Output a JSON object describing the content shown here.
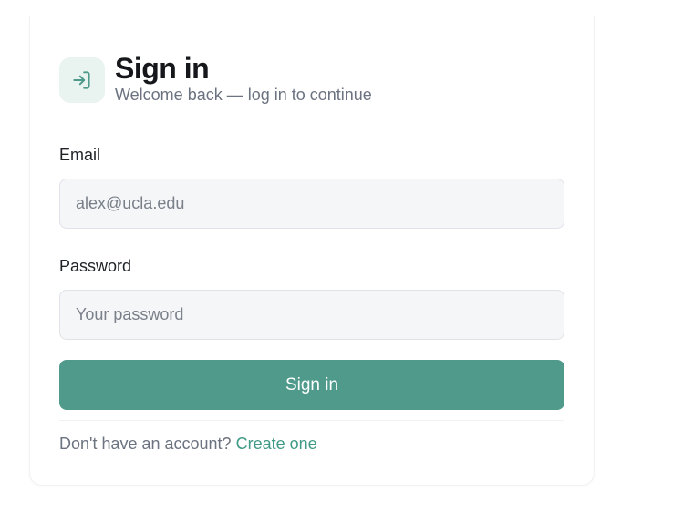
{
  "header": {
    "icon": "login-arrow-icon",
    "title": "Sign in",
    "subtitle": "Welcome back — log in to continue"
  },
  "form": {
    "email": {
      "label": "Email",
      "value": "",
      "placeholder": "alex@ucla.edu"
    },
    "password": {
      "label": "Password",
      "value": "",
      "placeholder": "Your password"
    },
    "submit_label": "Sign in"
  },
  "footer": {
    "prompt": "Don't have an account?",
    "link_label": "Create one"
  },
  "colors": {
    "accent": "#4f9a8b",
    "link": "#3f9a86",
    "icon_bg": "#e9f3f0"
  }
}
